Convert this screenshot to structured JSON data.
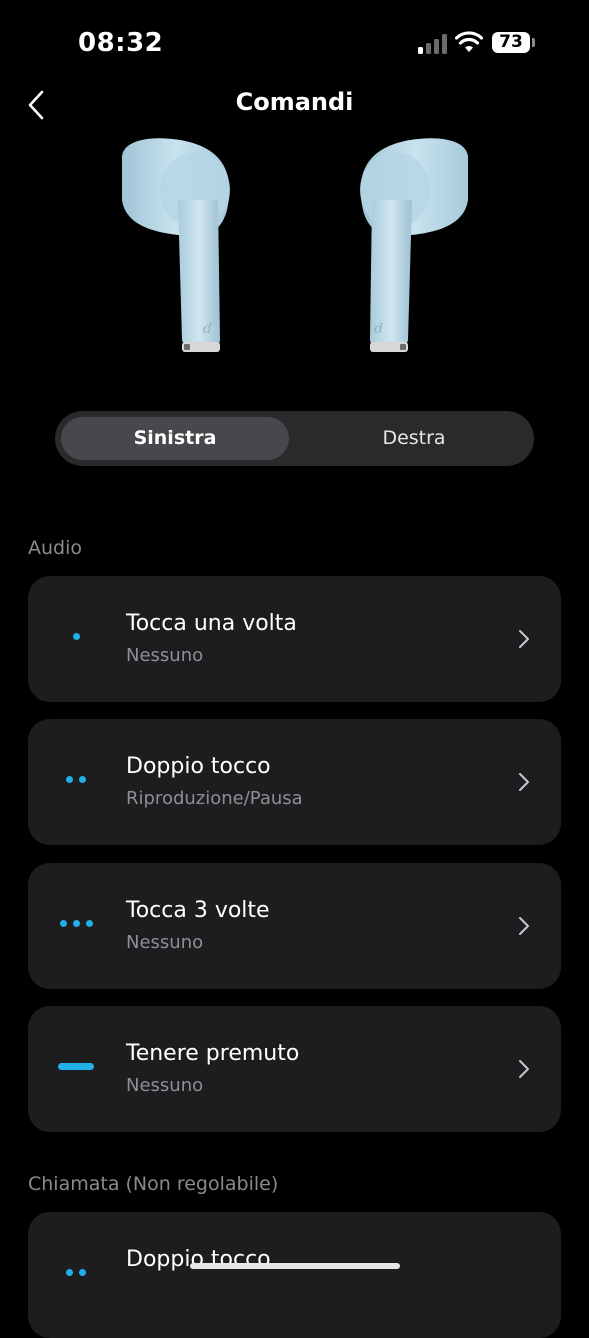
{
  "status": {
    "time": "08:32",
    "battery": "73"
  },
  "header": {
    "title": "Comandi"
  },
  "segments": {
    "left": "Sinistra",
    "right": "Destra"
  },
  "sections": {
    "audio": "Audio",
    "call": "Chiamata (Non regolabile)"
  },
  "audio_items": [
    {
      "title": "Tocca una volta",
      "value": "Nessuno",
      "icon": "single-tap-icon"
    },
    {
      "title": "Doppio tocco",
      "value": "Riproduzione/Pausa",
      "icon": "double-tap-icon"
    },
    {
      "title": "Tocca 3 volte",
      "value": "Nessuno",
      "icon": "triple-tap-icon"
    },
    {
      "title": "Tenere premuto",
      "value": "Nessuno",
      "icon": "press-hold-icon"
    }
  ],
  "call_items": [
    {
      "title": "Doppio tocco",
      "icon": "double-tap-icon"
    }
  ],
  "colors": {
    "accent": "#22aee6",
    "card": "#1d1d20",
    "background": "#000000"
  }
}
